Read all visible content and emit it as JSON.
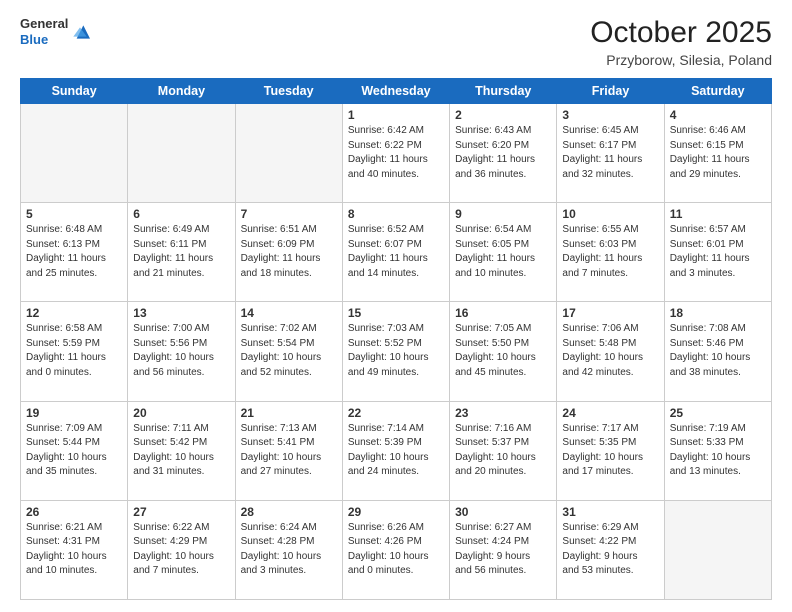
{
  "header": {
    "logo_general": "General",
    "logo_blue": "Blue",
    "month_title": "October 2025",
    "subtitle": "Przyborow, Silesia, Poland"
  },
  "weekdays": [
    "Sunday",
    "Monday",
    "Tuesday",
    "Wednesday",
    "Thursday",
    "Friday",
    "Saturday"
  ],
  "weeks": [
    [
      {
        "day": "",
        "text": ""
      },
      {
        "day": "",
        "text": ""
      },
      {
        "day": "",
        "text": ""
      },
      {
        "day": "1",
        "text": "Sunrise: 6:42 AM\nSunset: 6:22 PM\nDaylight: 11 hours\nand 40 minutes."
      },
      {
        "day": "2",
        "text": "Sunrise: 6:43 AM\nSunset: 6:20 PM\nDaylight: 11 hours\nand 36 minutes."
      },
      {
        "day": "3",
        "text": "Sunrise: 6:45 AM\nSunset: 6:17 PM\nDaylight: 11 hours\nand 32 minutes."
      },
      {
        "day": "4",
        "text": "Sunrise: 6:46 AM\nSunset: 6:15 PM\nDaylight: 11 hours\nand 29 minutes."
      }
    ],
    [
      {
        "day": "5",
        "text": "Sunrise: 6:48 AM\nSunset: 6:13 PM\nDaylight: 11 hours\nand 25 minutes."
      },
      {
        "day": "6",
        "text": "Sunrise: 6:49 AM\nSunset: 6:11 PM\nDaylight: 11 hours\nand 21 minutes."
      },
      {
        "day": "7",
        "text": "Sunrise: 6:51 AM\nSunset: 6:09 PM\nDaylight: 11 hours\nand 18 minutes."
      },
      {
        "day": "8",
        "text": "Sunrise: 6:52 AM\nSunset: 6:07 PM\nDaylight: 11 hours\nand 14 minutes."
      },
      {
        "day": "9",
        "text": "Sunrise: 6:54 AM\nSunset: 6:05 PM\nDaylight: 11 hours\nand 10 minutes."
      },
      {
        "day": "10",
        "text": "Sunrise: 6:55 AM\nSunset: 6:03 PM\nDaylight: 11 hours\nand 7 minutes."
      },
      {
        "day": "11",
        "text": "Sunrise: 6:57 AM\nSunset: 6:01 PM\nDaylight: 11 hours\nand 3 minutes."
      }
    ],
    [
      {
        "day": "12",
        "text": "Sunrise: 6:58 AM\nSunset: 5:59 PM\nDaylight: 11 hours\nand 0 minutes."
      },
      {
        "day": "13",
        "text": "Sunrise: 7:00 AM\nSunset: 5:56 PM\nDaylight: 10 hours\nand 56 minutes."
      },
      {
        "day": "14",
        "text": "Sunrise: 7:02 AM\nSunset: 5:54 PM\nDaylight: 10 hours\nand 52 minutes."
      },
      {
        "day": "15",
        "text": "Sunrise: 7:03 AM\nSunset: 5:52 PM\nDaylight: 10 hours\nand 49 minutes."
      },
      {
        "day": "16",
        "text": "Sunrise: 7:05 AM\nSunset: 5:50 PM\nDaylight: 10 hours\nand 45 minutes."
      },
      {
        "day": "17",
        "text": "Sunrise: 7:06 AM\nSunset: 5:48 PM\nDaylight: 10 hours\nand 42 minutes."
      },
      {
        "day": "18",
        "text": "Sunrise: 7:08 AM\nSunset: 5:46 PM\nDaylight: 10 hours\nand 38 minutes."
      }
    ],
    [
      {
        "day": "19",
        "text": "Sunrise: 7:09 AM\nSunset: 5:44 PM\nDaylight: 10 hours\nand 35 minutes."
      },
      {
        "day": "20",
        "text": "Sunrise: 7:11 AM\nSunset: 5:42 PM\nDaylight: 10 hours\nand 31 minutes."
      },
      {
        "day": "21",
        "text": "Sunrise: 7:13 AM\nSunset: 5:41 PM\nDaylight: 10 hours\nand 27 minutes."
      },
      {
        "day": "22",
        "text": "Sunrise: 7:14 AM\nSunset: 5:39 PM\nDaylight: 10 hours\nand 24 minutes."
      },
      {
        "day": "23",
        "text": "Sunrise: 7:16 AM\nSunset: 5:37 PM\nDaylight: 10 hours\nand 20 minutes."
      },
      {
        "day": "24",
        "text": "Sunrise: 7:17 AM\nSunset: 5:35 PM\nDaylight: 10 hours\nand 17 minutes."
      },
      {
        "day": "25",
        "text": "Sunrise: 7:19 AM\nSunset: 5:33 PM\nDaylight: 10 hours\nand 13 minutes."
      }
    ],
    [
      {
        "day": "26",
        "text": "Sunrise: 6:21 AM\nSunset: 4:31 PM\nDaylight: 10 hours\nand 10 minutes."
      },
      {
        "day": "27",
        "text": "Sunrise: 6:22 AM\nSunset: 4:29 PM\nDaylight: 10 hours\nand 7 minutes."
      },
      {
        "day": "28",
        "text": "Sunrise: 6:24 AM\nSunset: 4:28 PM\nDaylight: 10 hours\nand 3 minutes."
      },
      {
        "day": "29",
        "text": "Sunrise: 6:26 AM\nSunset: 4:26 PM\nDaylight: 10 hours\nand 0 minutes."
      },
      {
        "day": "30",
        "text": "Sunrise: 6:27 AM\nSunset: 4:24 PM\nDaylight: 9 hours\nand 56 minutes."
      },
      {
        "day": "31",
        "text": "Sunrise: 6:29 AM\nSunset: 4:22 PM\nDaylight: 9 hours\nand 53 minutes."
      },
      {
        "day": "",
        "text": ""
      }
    ]
  ]
}
